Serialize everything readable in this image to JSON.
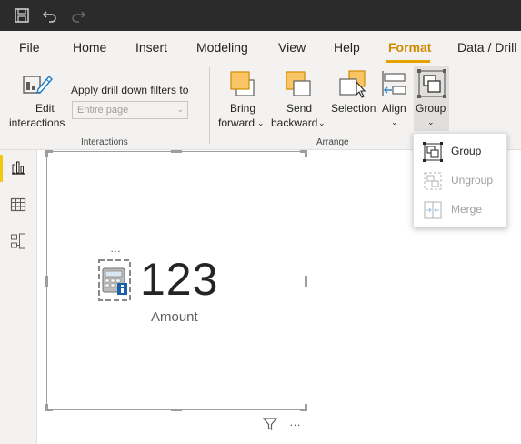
{
  "titlebar": {
    "icons": [
      "save-icon",
      "undo-icon",
      "redo-icon"
    ]
  },
  "tabs": [
    {
      "label": "File"
    },
    {
      "label": "Home"
    },
    {
      "label": "Insert"
    },
    {
      "label": "Modeling"
    },
    {
      "label": "View"
    },
    {
      "label": "Help"
    },
    {
      "label": "Format",
      "active": true
    },
    {
      "label": "Data / Drill"
    }
  ],
  "ribbon": {
    "edit_interactions": {
      "line1": "Edit",
      "line2": "interactions"
    },
    "drill_filter_label": "Apply drill down filters to",
    "drill_filter_value": "Entire page",
    "interactions_group": "Interactions",
    "bring_forward": {
      "line1": "Bring",
      "line2": "forward"
    },
    "send_backward": {
      "line1": "Send",
      "line2": "backward"
    },
    "selection": "Selection",
    "align": "Align",
    "group": "Group",
    "arrange_group": "Arrange"
  },
  "leftbar": {
    "icons": [
      "report-view-icon",
      "data-view-icon",
      "model-view-icon"
    ]
  },
  "visual": {
    "value": "123",
    "label": "Amount"
  },
  "group_menu": {
    "items": [
      {
        "label": "Group",
        "enabled": true
      },
      {
        "label": "Ungroup",
        "enabled": false
      },
      {
        "label": "Merge",
        "enabled": false
      }
    ]
  },
  "colors": {
    "accent": "#e5a200",
    "titlebar": "#2b2b2b",
    "ribbon": "#f3f2f1",
    "disabled_text": "#a19f9d"
  }
}
